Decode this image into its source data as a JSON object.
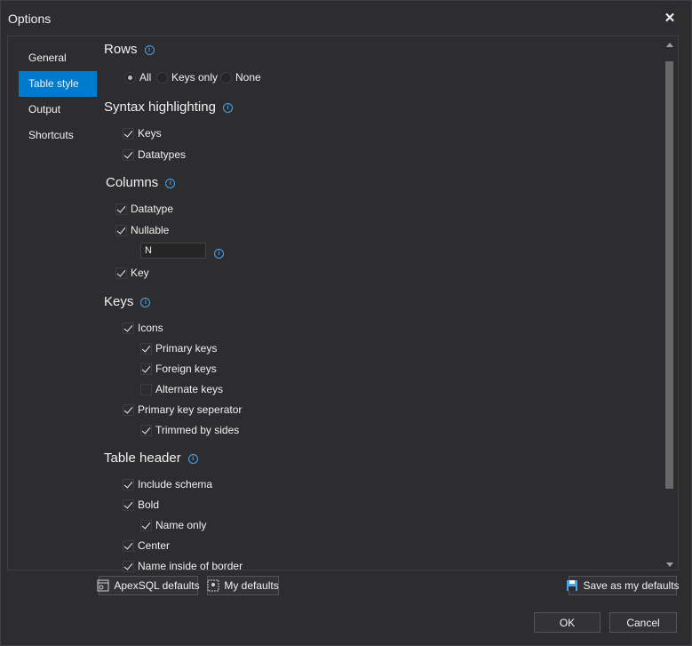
{
  "window": {
    "title": "Options"
  },
  "nav": {
    "items": [
      "General",
      "Table style",
      "Output",
      "Shortcuts"
    ],
    "active_index": 1
  },
  "rows": {
    "title": "Rows",
    "options": [
      "All",
      "Keys only",
      "None"
    ],
    "selected_index": 0
  },
  "syntax": {
    "title": "Syntax highlighting",
    "keys": {
      "label": "Keys",
      "checked": true
    },
    "datatypes": {
      "label": "Datatypes",
      "checked": true
    }
  },
  "columns": {
    "title": "Columns",
    "datatype": {
      "label": "Datatype",
      "checked": true
    },
    "nullable": {
      "label": "Nullable",
      "checked": true
    },
    "nullable_value": "N",
    "key": {
      "label": "Key",
      "checked": true
    }
  },
  "keys": {
    "title": "Keys",
    "icons": {
      "label": "Icons",
      "checked": true
    },
    "primary_keys": {
      "label": "Primary keys",
      "checked": true
    },
    "foreign_keys": {
      "label": "Foreign keys",
      "checked": true
    },
    "alternate_keys": {
      "label": "Alternate keys",
      "checked": false
    },
    "pk_separator": {
      "label": "Primary key seperator",
      "checked": true
    },
    "trimmed": {
      "label": "Trimmed by sides",
      "checked": true
    }
  },
  "table_header": {
    "title": "Table header",
    "include_schema": {
      "label": "Include schema",
      "checked": true
    },
    "bold": {
      "label": "Bold",
      "checked": true
    },
    "name_only": {
      "label": "Name only",
      "checked": true
    },
    "center": {
      "label": "Center",
      "checked": true
    },
    "name_inside_border": {
      "label": "Name inside of border",
      "checked": true
    }
  },
  "buttons": {
    "apexsql_defaults": "ApexSQL defaults",
    "my_defaults": "My defaults",
    "save_as_defaults": "Save as my defaults",
    "ok": "OK",
    "cancel": "Cancel"
  },
  "colors": {
    "background": "#2d2d30",
    "accent": "#007acc",
    "info_icon": "#4aa3e8",
    "text": "#f1f1f1"
  }
}
